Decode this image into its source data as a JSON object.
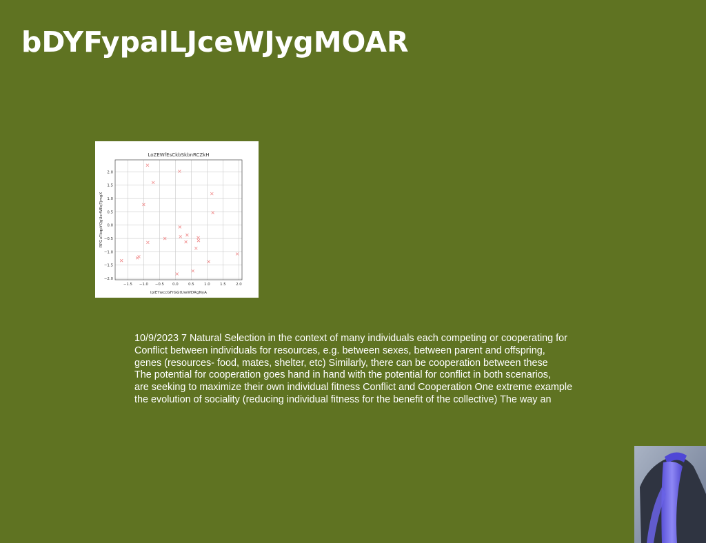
{
  "slide": {
    "title": "bDYFypalLJceWJygMOAR",
    "background_color": "#5f7322",
    "body_lines": [
      "10/9/2023 7 Natural Selection in the context of many individuals each competing or cooperating for",
      "Conflict between individuals for resources, e.g. between sexes, between parent and offspring,",
      "genes (resources- food, mates, shelter, etc) Similarly, there can be cooperation between these",
      "The potential for cooperation goes hand in hand with the potential for conflict in both scenarios,",
      "are seeking to maximize their own individual fitness Conflict and Cooperation One extreme example",
      "the evolution of sociality (reducing individual fitness for the benefit of the collective) The way an"
    ]
  },
  "chart_data": {
    "type": "scatter",
    "title": "LoZEWfEsCkbSkbnRCZkH",
    "xlabel": "lplEYwccGFrGGtUwWDRgNyA",
    "ylabel": "RPGuTbqpYQgUsrWEqTjmgX",
    "xlim": [
      -1.9,
      2.1
    ],
    "ylim": [
      -2.05,
      2.45
    ],
    "xticks": [
      "-1.5",
      "-1.0",
      "-0.5",
      "0.0",
      "0.5",
      "1.0",
      "1.5",
      "2.0"
    ],
    "yticks": [
      "2.0",
      "1.5",
      "1.0",
      "0.5",
      "0.0",
      "-0.5",
      "-1.0",
      "-1.5",
      "-2.0"
    ],
    "grid": true,
    "marker": "x",
    "marker_color": "#f08a8a",
    "points": [
      {
        "x": -1.7,
        "y": -1.33
      },
      {
        "x": -1.2,
        "y": -1.23
      },
      {
        "x": -1.15,
        "y": -1.18
      },
      {
        "x": -1.0,
        "y": 0.77
      },
      {
        "x": -0.88,
        "y": 2.25
      },
      {
        "x": -0.87,
        "y": -0.65
      },
      {
        "x": -0.7,
        "y": 1.6
      },
      {
        "x": -0.33,
        "y": -0.5
      },
      {
        "x": 0.05,
        "y": -1.83
      },
      {
        "x": 0.13,
        "y": 2.02
      },
      {
        "x": 0.14,
        "y": -0.07
      },
      {
        "x": 0.16,
        "y": -0.43
      },
      {
        "x": 0.33,
        "y": -0.63
      },
      {
        "x": 0.37,
        "y": -0.37
      },
      {
        "x": 0.55,
        "y": -1.72
      },
      {
        "x": 0.65,
        "y": -0.87
      },
      {
        "x": 0.72,
        "y": -0.47
      },
      {
        "x": 0.73,
        "y": -0.58
      },
      {
        "x": 1.05,
        "y": -1.37
      },
      {
        "x": 1.15,
        "y": 1.18
      },
      {
        "x": 1.18,
        "y": 0.47
      },
      {
        "x": 1.95,
        "y": -1.08
      }
    ]
  },
  "photo": {
    "description_icon": "person-shoulder-photo",
    "colors": {
      "backdrop": "#8a97ad",
      "skin": "#2f3441",
      "fabric": "#6a63e6",
      "fabric_highlight": "#8e88f5"
    }
  }
}
